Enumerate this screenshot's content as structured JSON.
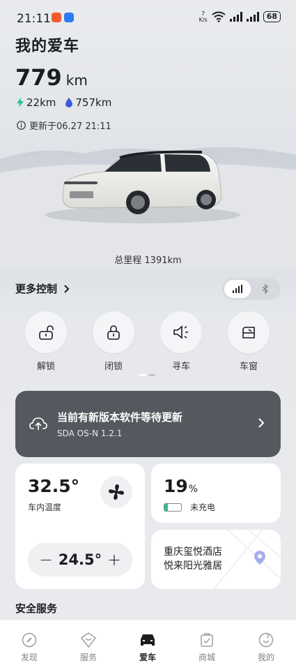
{
  "status_bar": {
    "time": "21:11",
    "net_speed_value": "7",
    "net_speed_unit": "K/s",
    "battery": "68"
  },
  "header": {
    "title": "我的爱车",
    "range_value": "779",
    "range_unit": "km",
    "electric_range": "22km",
    "fuel_range": "757km",
    "update_text": "更新于06.27 21:11"
  },
  "car": {
    "odometer": "总里程 1391km"
  },
  "controls": {
    "section_label": "更多控制",
    "items": [
      {
        "label": "解锁",
        "icon": "unlock-icon"
      },
      {
        "label": "闭锁",
        "icon": "lock-icon"
      },
      {
        "label": "寻车",
        "icon": "horn-icon"
      },
      {
        "label": "车窗",
        "icon": "window-icon"
      }
    ]
  },
  "update_card": {
    "title": "当前有新版本软件等待更新",
    "version": "SDA OS-N 1.2.1"
  },
  "climate": {
    "inside_temp": "32.5°",
    "inside_label": "车内温度",
    "set_temp": "24.5°",
    "minus": "−",
    "plus": "+"
  },
  "charge": {
    "percent": "19",
    "percent_unit": "%",
    "level": 0.19,
    "status": "未充电"
  },
  "location": {
    "line1": "重庆玺悦酒店",
    "line2": "悦来阳光雅居"
  },
  "safety": {
    "title": "安全服务"
  },
  "nav": {
    "items": [
      {
        "label": "发现",
        "icon": "compass-icon"
      },
      {
        "label": "服务",
        "icon": "service-icon"
      },
      {
        "label": "爱车",
        "icon": "car-icon"
      },
      {
        "label": "商城",
        "icon": "shop-icon"
      },
      {
        "label": "我的",
        "icon": "profile-icon"
      }
    ],
    "active_index": 2
  },
  "colors": {
    "accent_green": "#2ec28a",
    "fuel_blue": "#3d5bd8",
    "update_card_bg": "#55595f"
  }
}
